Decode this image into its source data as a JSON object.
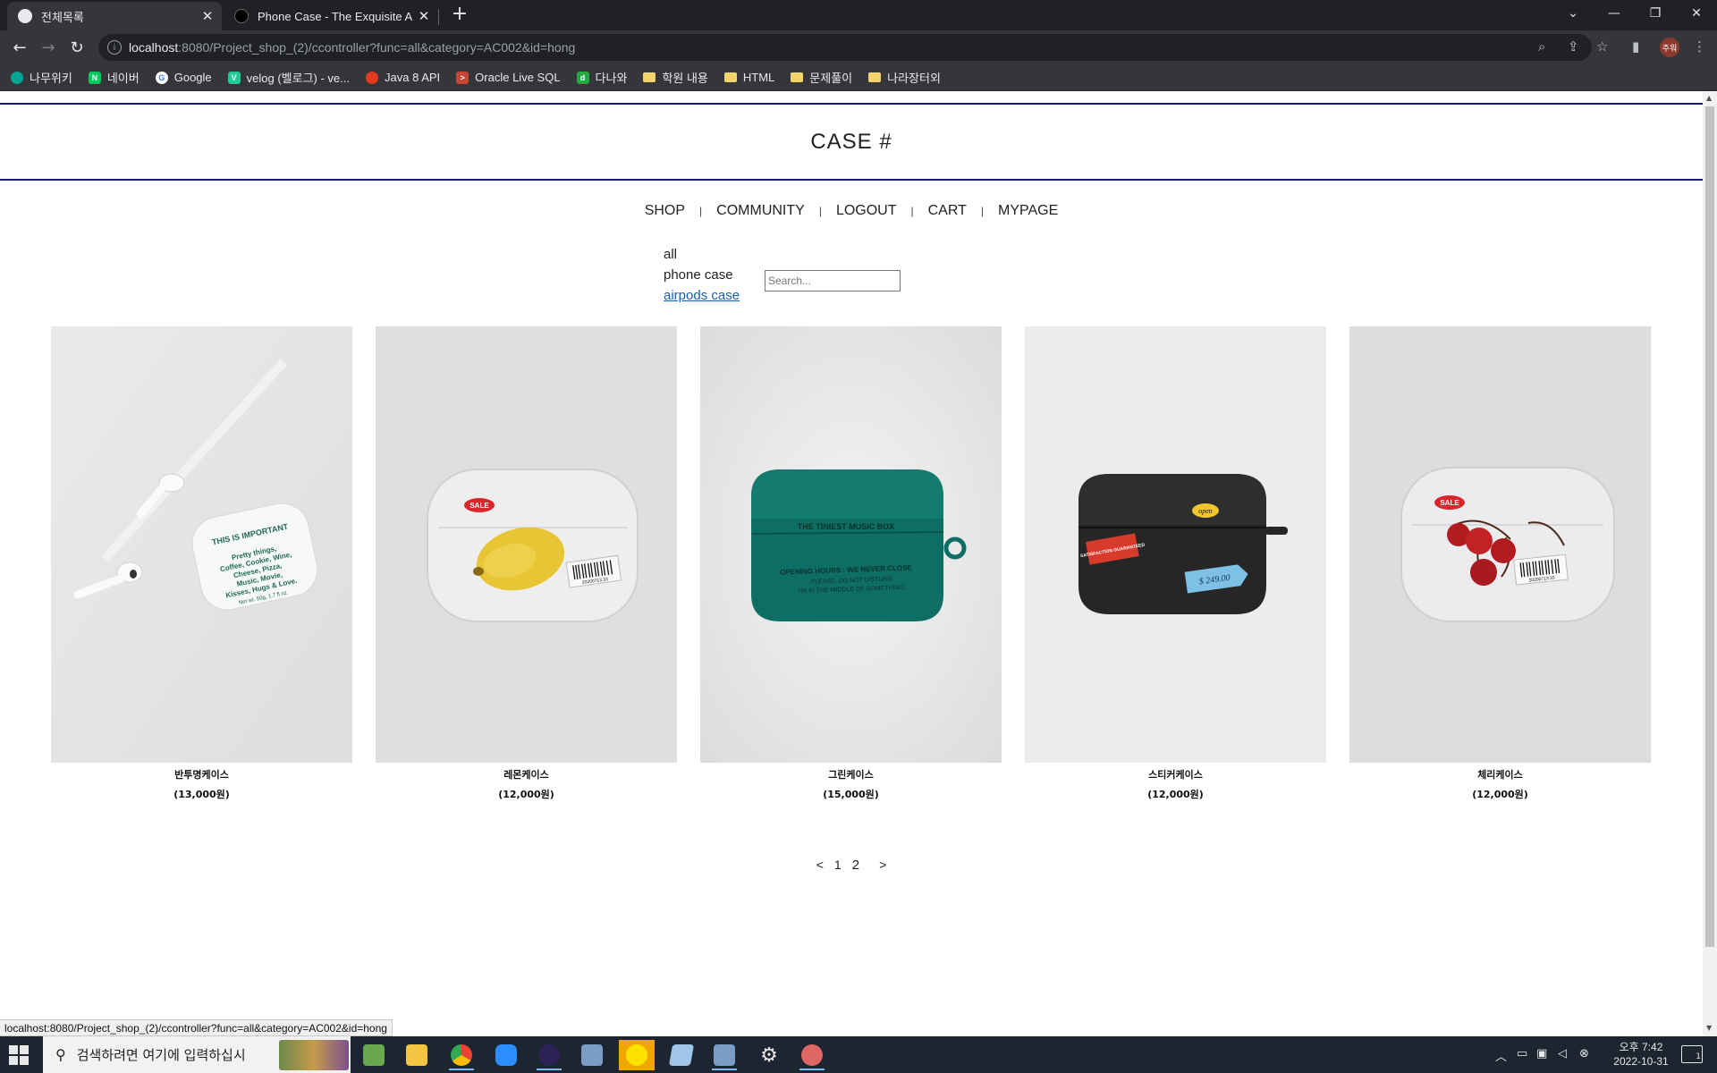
{
  "browser": {
    "tabs": [
      {
        "title": "전체목록",
        "active": true
      },
      {
        "title": "Phone Case - The Exquisite Arc",
        "active": false
      }
    ],
    "url_host": "localhost",
    "url_path": ":8080/Project_shop_(2)/ccontroller?func=all&category=AC002&id=hong",
    "profile_label": "주워",
    "bookmarks": [
      {
        "label": "나무위키",
        "icon": "namuwiki-icon",
        "color": "#00a495"
      },
      {
        "label": "네이버",
        "icon": "naver-icon",
        "color": "#03c75a"
      },
      {
        "label": "Google",
        "icon": "google-icon",
        "color": "#ffffff"
      },
      {
        "label": "velog (벨로그) - ve...",
        "icon": "velog-icon",
        "color": "#20c997"
      },
      {
        "label": "Java 8 API",
        "icon": "oracle-icon",
        "color": "#e23a1e"
      },
      {
        "label": "Oracle Live SQL",
        "icon": "terminal-icon",
        "color": "#c74634"
      },
      {
        "label": "다나와",
        "icon": "danawa-icon",
        "color": "#27a843"
      },
      {
        "label": "학원 내용",
        "icon": "folder-icon",
        "color": "#f4d36b"
      },
      {
        "label": "HTML",
        "icon": "folder-icon",
        "color": "#f4d36b"
      },
      {
        "label": "문제풀이",
        "icon": "folder-icon",
        "color": "#f4d36b"
      },
      {
        "label": "나라장터외",
        "icon": "folder-icon",
        "color": "#f4d36b"
      }
    ]
  },
  "site": {
    "brand": "CASE #",
    "nav": [
      "SHOP",
      "COMMUNITY",
      "LOGOUT",
      "CART",
      "MYPAGE"
    ],
    "nav_separator": "|",
    "categories": [
      "all",
      "phone case",
      "airpods case"
    ],
    "active_category": "airpods case",
    "search_placeholder": "Search...",
    "products": [
      {
        "name": "반투명케이스",
        "price": "(13,000원)",
        "theme": "text-case"
      },
      {
        "name": "레몬케이스",
        "price": "(12,000원)",
        "theme": "lemon-case"
      },
      {
        "name": "그린케이스",
        "price": "(15,000원)",
        "theme": "green-case"
      },
      {
        "name": "스티커케이스",
        "price": "(12,000원)",
        "theme": "black-case"
      },
      {
        "name": "체리케이스",
        "price": "(12,000원)",
        "theme": "cherry-case"
      }
    ],
    "pagination": {
      "prev": "<",
      "pages": [
        "1",
        "2"
      ],
      "current": "2",
      "next": ">"
    }
  },
  "photo_labels": {
    "text_case_title": "THIS IS IMPORTANT",
    "text_case_body": [
      "Pretty things,",
      "Coffee, Cookie, Wine,",
      "Cheese, Pizza,",
      "Music, Movie,",
      "Kisses, Hugs & Love."
    ],
    "text_case_footer": "Net wt. 50g, 1.7 fl oz.",
    "sale": "SALE",
    "barcode": "20200713 33",
    "green_title": "THE TINIEST MUSIC BOX",
    "green_line1": "OPENING HOURS : WE NEVER CLOSE",
    "green_line2": "PLEASE, DO NOT DISTURB.",
    "green_line3": "I'M IN THE MIDDLE OF SOMETHING.",
    "open": "open",
    "satisfaction": "SATISFACTION GUARANTEED",
    "price_tag": "$ 249.00"
  },
  "status_url": "localhost:8080/Project_shop_(2)/ccontroller?func=all&category=AC002&id=hong",
  "taskbar": {
    "search_placeholder": "검색하려면 여기에 입력하십시",
    "clock_time": "오후 7:42",
    "clock_date": "2022-10-31",
    "notification_count": "1"
  }
}
